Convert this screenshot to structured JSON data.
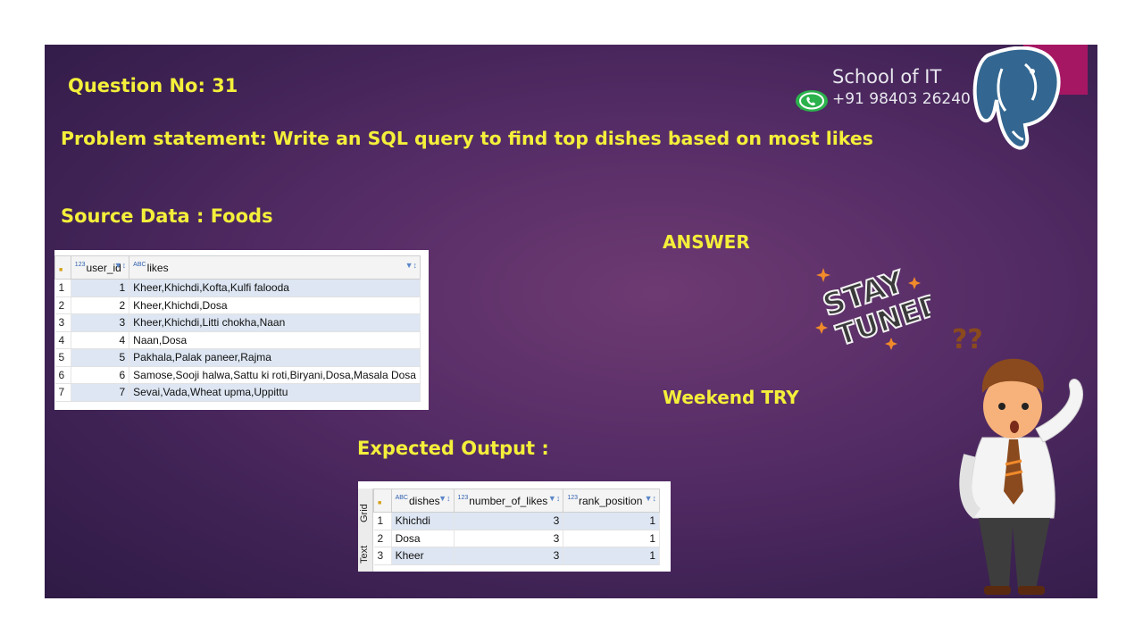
{
  "slide": {
    "question": "Question No: 31",
    "problem": "Problem statement:  Write an SQL query to find top dishes based on most likes",
    "source": "Source Data  : Foods",
    "answer": "ANSWER",
    "weekend": "Weekend TRY",
    "expected": "Expected Output  :",
    "brand_name": "School of IT",
    "brand_phone": "+91 98403 26240",
    "stay_line1": "STAY",
    "stay_line2": "TUNED",
    "question_marks": "??"
  },
  "source_grid": {
    "headers": [
      "user_id",
      "likes"
    ],
    "header_types": [
      "123",
      "ABC"
    ],
    "rows": [
      {
        "rn": "1",
        "user_id": "1",
        "likes": "Kheer,Khichdi,Kofta,Kulfi falooda"
      },
      {
        "rn": "2",
        "user_id": "2",
        "likes": "Kheer,Khichdi,Dosa"
      },
      {
        "rn": "3",
        "user_id": "3",
        "likes": "Kheer,Khichdi,Litti chokha,Naan"
      },
      {
        "rn": "4",
        "user_id": "4",
        "likes": "Naan,Dosa"
      },
      {
        "rn": "5",
        "user_id": "5",
        "likes": "Pakhala,Palak paneer,Rajma"
      },
      {
        "rn": "6",
        "user_id": "6",
        "likes": "Samose,Sooji halwa,Sattu ki roti,Biryani,Dosa,Masala Dosa"
      },
      {
        "rn": "7",
        "user_id": "7",
        "likes": "Sevai,Vada,Wheat upma,Uppittu"
      }
    ]
  },
  "output_grid": {
    "headers": [
      "dishes",
      "number_of_likes",
      "rank_position"
    ],
    "header_types": [
      "ABC",
      "123",
      "123"
    ],
    "side_tabs": [
      "Grid",
      "Text"
    ],
    "rows": [
      {
        "rn": "1",
        "dishes": "Khichdi",
        "number_of_likes": "3",
        "rank_position": "1"
      },
      {
        "rn": "2",
        "dishes": "Dosa",
        "number_of_likes": "3",
        "rank_position": "1"
      },
      {
        "rn": "3",
        "dishes": "Kheer",
        "number_of_likes": "3",
        "rank_position": "1"
      }
    ]
  },
  "colors": {
    "headline": "#f4ef3a",
    "slide_bg": "#552c66",
    "accent_tab": "#a61763",
    "grid_alt_row": "#dde6f2"
  },
  "icons": [
    "whatsapp-icon",
    "postgresql-elephant-icon",
    "filter-sort-icon",
    "confused-man-illustration",
    "stay-tuned-sticker"
  ]
}
